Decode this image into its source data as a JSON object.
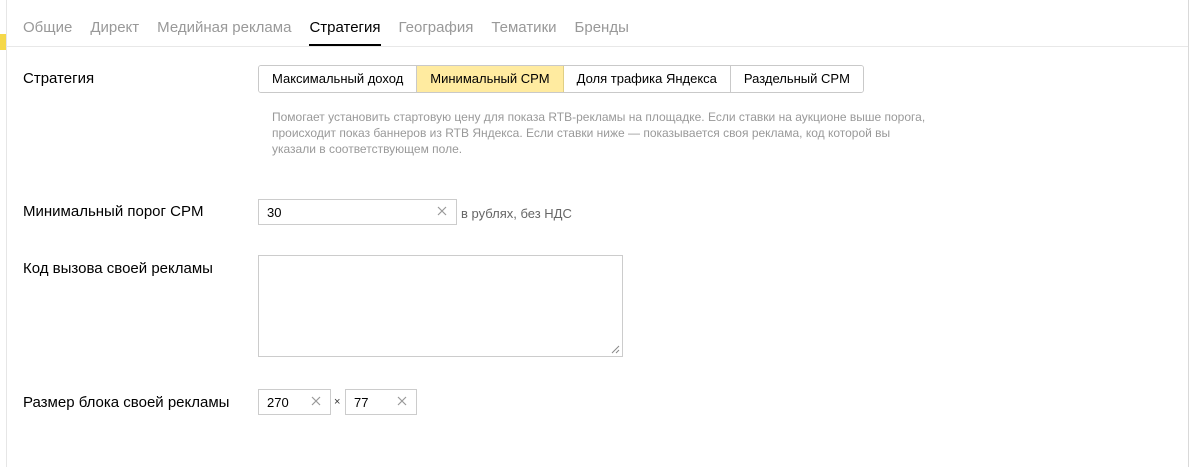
{
  "tabs": [
    {
      "label": "Общие",
      "active": false
    },
    {
      "label": "Директ",
      "active": false
    },
    {
      "label": "Медийная реклама",
      "active": false
    },
    {
      "label": "Стратегия",
      "active": true
    },
    {
      "label": "География",
      "active": false
    },
    {
      "label": "Тематики",
      "active": false
    },
    {
      "label": "Бренды",
      "active": false
    }
  ],
  "strategy": {
    "label": "Стратегия",
    "options": [
      "Максимальный доход",
      "Минимальный CPM",
      "Доля трафика Яндекса",
      "Раздельный CPM"
    ],
    "selected_index": 1,
    "hint": "Помогает установить стартовую цену для показа RTB-рекламы на площадке. Если ставки на аукционе выше порога, происходит показ баннеров из RTB Яндекса. Если ставки ниже — показывается своя реклама, код которой вы указали в соответствующем поле."
  },
  "min_cpm": {
    "label": "Минимальный порог CPM",
    "value": "30",
    "suffix": "в рублях, без НДС"
  },
  "own_code": {
    "label": "Код вызова своей рекламы",
    "value": ""
  },
  "block_size": {
    "label": "Размер блока своей рекламы",
    "width": "270",
    "separator": "×",
    "height": "77"
  },
  "colors": {
    "selected_bg": "#ffeba0",
    "active_tab": "#000000",
    "inactive_tab": "#999999",
    "hint_text": "#999999"
  },
  "icons": {
    "clear": "close-icon",
    "resize": "resize-grip-icon"
  }
}
